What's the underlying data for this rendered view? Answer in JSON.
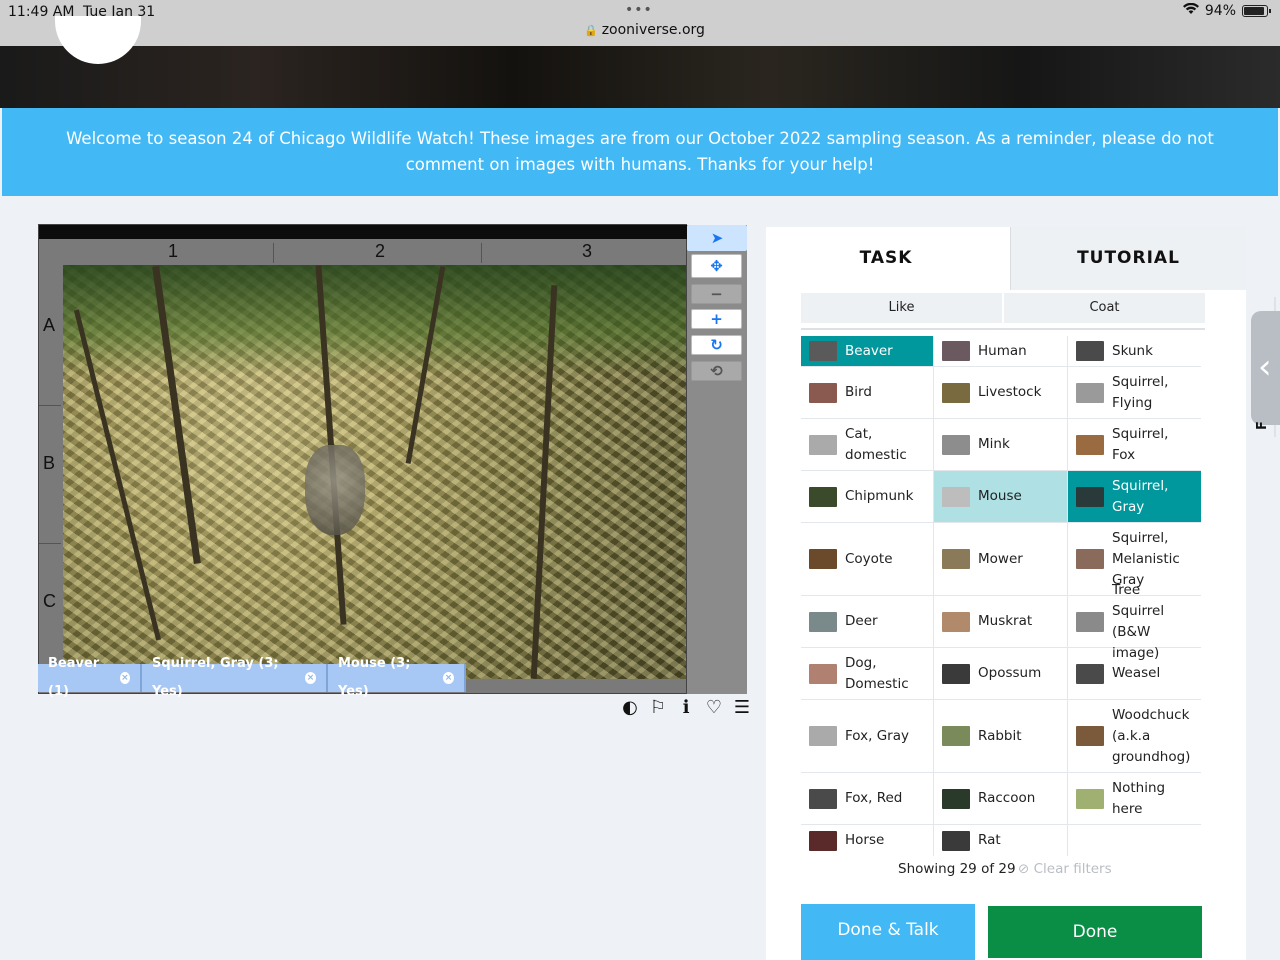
{
  "status_bar": {
    "time": "11:49 AM",
    "date": "Tue Jan 31",
    "dots": "•••",
    "url": "zooniverse.org",
    "battery": "94%"
  },
  "announcement": "Welcome to season 24 of Chicago Wildlife Watch! These images are from our October 2022 sampling season. As a reminder, please do not comment on images with humans. Thanks for your help!",
  "viewer": {
    "columns": [
      "1",
      "2",
      "3"
    ],
    "rows": [
      "A",
      "B",
      "C"
    ],
    "marks": [
      {
        "label": "Beaver (1)"
      },
      {
        "label": "Squirrel, Gray (3; Yes)"
      },
      {
        "label": "Mouse (3; Yes)"
      }
    ],
    "tools": {
      "pointer": "➤",
      "move": "✥",
      "zoom_out": "−",
      "zoom_in": "+",
      "rotate": "↻",
      "reset": "⟲"
    },
    "icons": {
      "invert": "◐",
      "flag": "⚐",
      "info": "ℹ",
      "favorite": "♡",
      "collections": "☰"
    }
  },
  "task_panel": {
    "tabs": {
      "task": "TASK",
      "tutorial": "TUTORIAL"
    },
    "filters": {
      "like": "Like",
      "coat": "Coat"
    },
    "choices": [
      {
        "label": "Beaver",
        "thumb": "#5a5a5a",
        "state": "selected"
      },
      {
        "label": "Human",
        "thumb": "#6a5a60",
        "state": ""
      },
      {
        "label": "Skunk",
        "thumb": "#4a4a4a",
        "state": ""
      },
      {
        "label": "Bird",
        "thumb": "#8a5a50",
        "state": ""
      },
      {
        "label": "Livestock",
        "thumb": "#7a6a40",
        "state": ""
      },
      {
        "label": "Squirrel, Flying",
        "thumb": "#9a9a9a",
        "state": ""
      },
      {
        "label": "Cat, domestic",
        "thumb": "#aaaaaa",
        "state": ""
      },
      {
        "label": "Mink",
        "thumb": "#8d8d8d",
        "state": ""
      },
      {
        "label": "Squirrel, Fox",
        "thumb": "#9a6a40",
        "state": ""
      },
      {
        "label": "Chipmunk",
        "thumb": "#3a4a2a",
        "state": ""
      },
      {
        "label": "Mouse",
        "thumb": "#bdbdbd",
        "state": "hover"
      },
      {
        "label": "Squirrel, Gray",
        "thumb": "#2a3a3a",
        "state": "selected"
      },
      {
        "label": "Coyote",
        "thumb": "#6a4a2a",
        "state": ""
      },
      {
        "label": "Mower",
        "thumb": "#8a7a5a",
        "state": ""
      },
      {
        "label": "Squirrel, Melanistic Gray",
        "thumb": "#8a6a5a",
        "state": ""
      },
      {
        "label": "Deer",
        "thumb": "#7a8a8a",
        "state": ""
      },
      {
        "label": "Muskrat",
        "thumb": "#b08a6a",
        "state": ""
      },
      {
        "label": "Tree Squirrel (B&W image)",
        "thumb": "#8a8a8a",
        "state": ""
      },
      {
        "label": "Dog, Domestic",
        "thumb": "#b08070",
        "state": ""
      },
      {
        "label": "Opossum",
        "thumb": "#3a3a3a",
        "state": ""
      },
      {
        "label": "Weasel",
        "thumb": "#4a4a4a",
        "state": ""
      },
      {
        "label": "Fox, Gray",
        "thumb": "#aaaaaa",
        "state": ""
      },
      {
        "label": "Rabbit",
        "thumb": "#7a8a5a",
        "state": ""
      },
      {
        "label": "Woodchuck (a.k.a groundhog)",
        "thumb": "#7a5a3a",
        "state": ""
      },
      {
        "label": "Fox, Red",
        "thumb": "#4a4a4a",
        "state": ""
      },
      {
        "label": "Raccoon",
        "thumb": "#2a3a2a",
        "state": ""
      },
      {
        "label": "Nothing here",
        "thumb": "#a0b070",
        "state": ""
      },
      {
        "label": "Horse",
        "thumb": "#5a2a2a",
        "state": ""
      },
      {
        "label": "Rat",
        "thumb": "#3a3a3a",
        "state": ""
      }
    ],
    "showing": "Showing 29 of 29",
    "clear_filters": "Clear filters",
    "clear_icon": "⊘",
    "done_talk": "Done & Talk",
    "done": "Done"
  },
  "side_tab": {
    "chevron": "‹",
    "letter": "F"
  }
}
